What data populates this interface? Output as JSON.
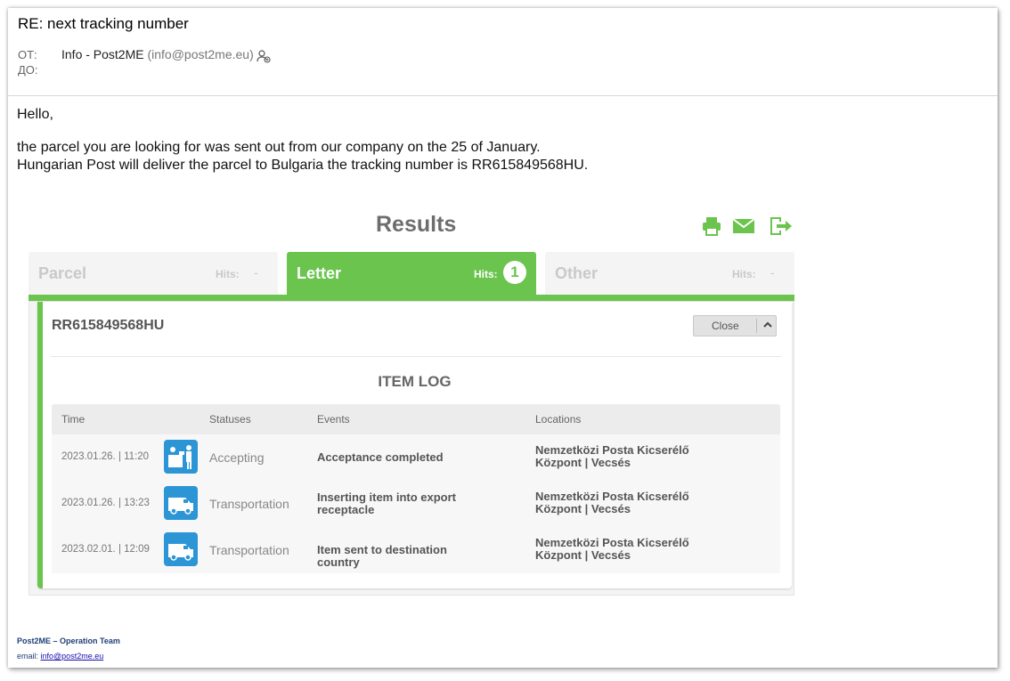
{
  "email": {
    "subject": "RE: next tracking number",
    "from_label": "ОТ:",
    "to_label": "ДО:",
    "from_name": "Info - Post2ME",
    "from_address": "(info@post2me.eu)",
    "icons": [
      "contact-add-icon"
    ],
    "body": {
      "greeting": "Hello,",
      "line1": "the parcel you are looking for was sent out from our company on the 25 of January.",
      "line2": "Hungarian Post will deliver the parcel to Bulgaria the tracking number is RR615849568HU."
    }
  },
  "results": {
    "title": "Results",
    "actions": [
      "print-icon",
      "mail-icon",
      "export-icon"
    ],
    "tabs": [
      {
        "name": "Parcel",
        "hits_label": "Hits:",
        "hits": "-",
        "active": false
      },
      {
        "name": "Letter",
        "hits_label": "Hits:",
        "hits": "1",
        "active": true
      },
      {
        "name": "Other",
        "hits_label": "Hits:",
        "hits": "-",
        "active": false
      }
    ],
    "tracking_number": "RR615849568HU",
    "close_label": "Close",
    "log_title": "ITEM LOG",
    "columns": [
      "Time",
      "Statuses",
      "Events",
      "Locations"
    ],
    "rows": [
      {
        "time": "2023.01.26. | 11:20",
        "icon": "acceptance-counter-icon",
        "status": "Accepting",
        "event": "Acceptance completed",
        "location_1": "Nemzetközi Posta Kicserélő",
        "location_2": "Központ | Vecsés"
      },
      {
        "time": "2023.01.26. | 13:23",
        "icon": "van-icon",
        "status": "Transportation",
        "event": "Inserting item into export receptacle",
        "location_1": "Nemzetközi Posta Kicserélő",
        "location_2": "Központ | Vecsés"
      },
      {
        "time": "2023.02.01. | 12:09",
        "icon": "van-icon",
        "status": "Transportation",
        "event": "Item sent to destination country",
        "location_1": "Nemzetközi Posta Kicserélő",
        "location_2": "Központ | Vecsés"
      }
    ],
    "colors": {
      "accent": "#6ac44d",
      "status_icon": "#2b95d6"
    }
  },
  "signature": {
    "team": "Post2ME – Operation Team",
    "email_label": "email:",
    "email": "info@post2me.eu"
  }
}
